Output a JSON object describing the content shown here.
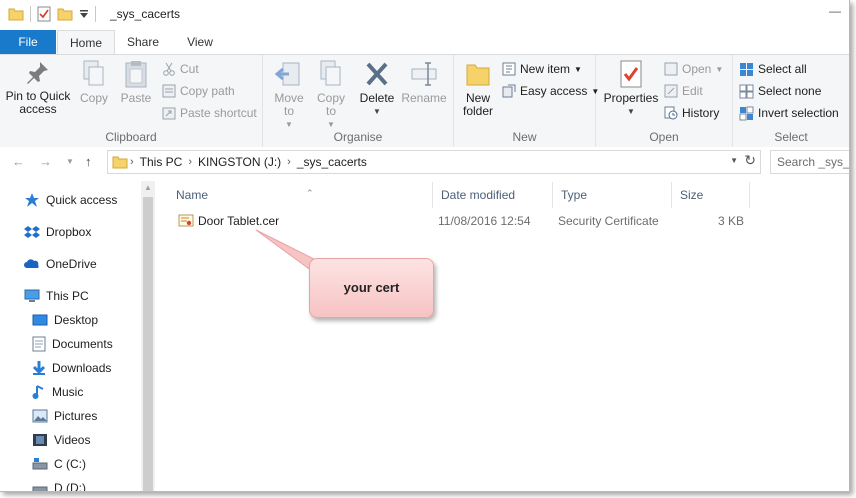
{
  "window": {
    "title": "_sys_cacerts",
    "accent_color": "#1979ca"
  },
  "quick_access_toolbar": [
    "folder-icon",
    "properties-icon",
    "new-folder-icon",
    "customize-dropdown-icon"
  ],
  "ribbon_tabs": [
    {
      "label": "File",
      "active": false
    },
    {
      "label": "Home",
      "active": true
    },
    {
      "label": "Share",
      "active": false
    },
    {
      "label": "View",
      "active": false
    }
  ],
  "ribbon": {
    "clipboard": {
      "label": "Clipboard",
      "pin_to_quick_access": "Pin to Quick access",
      "copy": "Copy",
      "paste": "Paste",
      "cut": "Cut",
      "copy_path": "Copy path",
      "paste_shortcut": "Paste shortcut"
    },
    "organise": {
      "label": "Organise",
      "move_to": "Move to",
      "copy_to": "Copy to",
      "delete": "Delete",
      "rename": "Rename"
    },
    "new": {
      "label": "New",
      "new_folder": "New folder",
      "new_item": "New item",
      "easy_access": "Easy access"
    },
    "open": {
      "label": "Open",
      "properties": "Properties",
      "open": "Open",
      "edit": "Edit",
      "history": "History"
    },
    "select": {
      "label": "Select",
      "select_all": "Select all",
      "select_none": "Select none",
      "invert_selection": "Invert selection"
    }
  },
  "address_bar": {
    "breadcrumbs": [
      "This PC",
      "KINGSTON (J:)",
      "_sys_cacerts"
    ],
    "search_placeholder": "Search _sys_c"
  },
  "nav_pane": {
    "items": [
      {
        "label": "Quick access",
        "icon": "star-icon"
      },
      {
        "label": "Dropbox",
        "icon": "dropbox-icon"
      },
      {
        "label": "OneDrive",
        "icon": "onedrive-icon"
      },
      {
        "label": "This PC",
        "icon": "computer-icon"
      },
      {
        "label": "Desktop",
        "icon": "desktop-icon"
      },
      {
        "label": "Documents",
        "icon": "documents-icon"
      },
      {
        "label": "Downloads",
        "icon": "downloads-icon"
      },
      {
        "label": "Music",
        "icon": "music-icon"
      },
      {
        "label": "Pictures",
        "icon": "pictures-icon"
      },
      {
        "label": "Videos",
        "icon": "videos-icon"
      },
      {
        "label": "C (C:)",
        "icon": "drive-icon"
      },
      {
        "label": "D (D:)",
        "icon": "drive-icon"
      }
    ]
  },
  "file_list": {
    "columns": [
      "Name",
      "Date modified",
      "Type",
      "Size"
    ],
    "rows": [
      {
        "name": "Door Tablet.cer",
        "date_modified": "11/08/2016 12:54",
        "type": "Security Certificate",
        "size": "3 KB",
        "icon": "certificate-icon"
      }
    ]
  },
  "annotation": {
    "text": "your cert",
    "color": "#f7c3c3"
  }
}
